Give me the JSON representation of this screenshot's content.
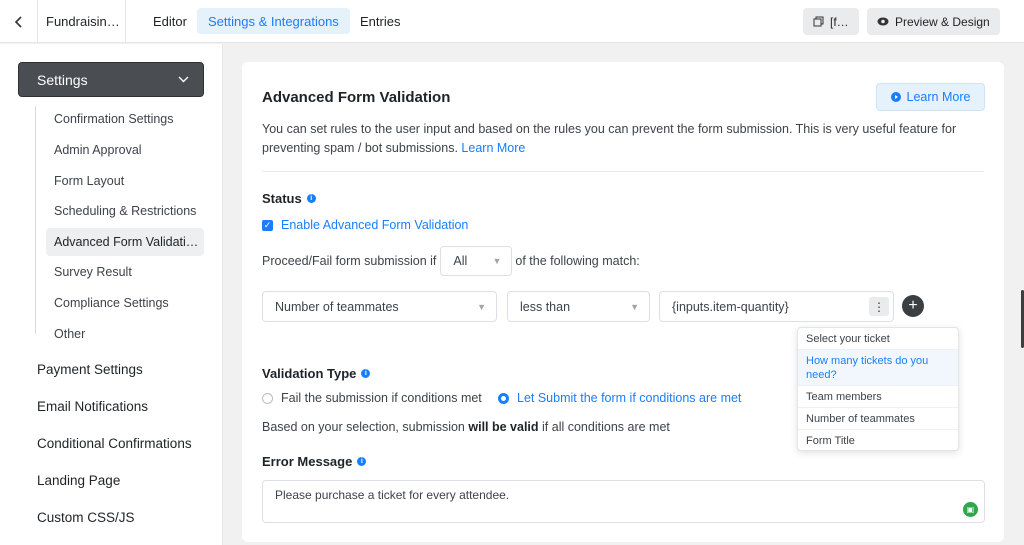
{
  "header": {
    "form_name": "Fundraisin…",
    "tabs": [
      "Editor",
      "Settings & Integrations",
      "Entries"
    ],
    "shortcode_label": "[f…",
    "preview_label": "Preview & Design"
  },
  "sidebar": {
    "section_label": "Settings",
    "sub_items": [
      "Confirmation Settings",
      "Admin Approval",
      "Form Layout",
      "Scheduling & Restrictions",
      "Advanced Form Validati…",
      "Survey Result",
      "Compliance Settings",
      "Other"
    ],
    "main_items": [
      "Payment Settings",
      "Email Notifications",
      "Conditional Confirmations",
      "Landing Page",
      "Custom CSS/JS"
    ]
  },
  "card": {
    "title": "Advanced Form Validation",
    "learn_more": "Learn More",
    "description": "You can set rules to the user input and based on the rules you can prevent the form submission. This is very useful feature for preventing spam / bot submissions.",
    "description_link": "Learn More",
    "status_label": "Status",
    "enable_label": "Enable Advanced Form Validation",
    "proceed_prefix": "Proceed/Fail form submission if",
    "match_value": "All",
    "proceed_suffix": "of the following match:",
    "condition": {
      "field": "Number of teammates",
      "operator": "less than",
      "value": "{inputs.item-quantity}"
    },
    "validation_type_label": "Validation Type",
    "radio_fail": "Fail the submission if conditions met",
    "radio_submit": "Let Submit the form if conditions are met",
    "note_prefix": "Based on your selection, submission",
    "note_bold": "will be valid",
    "note_suffix": "if all conditions are met",
    "error_message_label": "Error Message",
    "error_message_value": "Please purchase a ticket for every attendee."
  },
  "dropdown": {
    "items": [
      "Select your ticket",
      "How many tickets do you need?",
      "Team members",
      "Number of teammates",
      "Form Title"
    ]
  }
}
